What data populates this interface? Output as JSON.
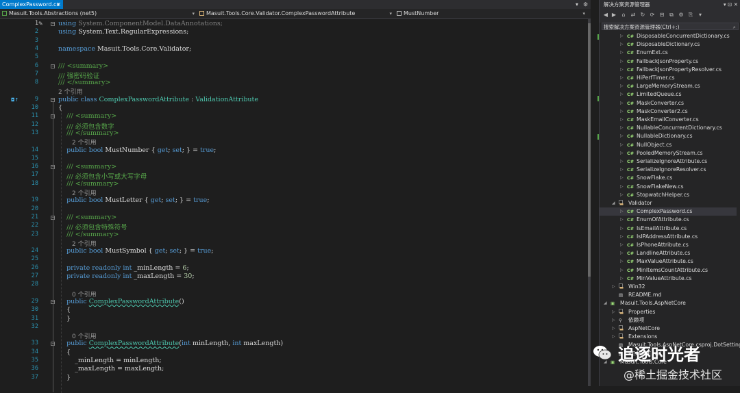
{
  "editor": {
    "tab_label": "ComplexPassword.cs",
    "nav": {
      "project": "Masuit.Tools.Abstractions (net5)",
      "type": "Masuit.Tools.Core.Validator.ComplexPasswordAttribute",
      "member": "MustNumber"
    },
    "lines": [
      {
        "n": "1",
        "parts": [
          {
            "t": "using ",
            "c": "kw"
          },
          {
            "t": "System.ComponentModel.DataAnnotations;",
            "c": "gr"
          }
        ]
      },
      {
        "n": "2",
        "parts": [
          {
            "t": "using ",
            "c": "kw"
          },
          {
            "t": "System.Text.RegularExpressions;",
            "c": ""
          }
        ]
      },
      {
        "n": "3",
        "parts": []
      },
      {
        "n": "4",
        "parts": [
          {
            "t": "namespace ",
            "c": "kw"
          },
          {
            "t": "Masuit.Tools.Core.Validator;",
            "c": ""
          }
        ]
      },
      {
        "n": "5",
        "parts": []
      },
      {
        "n": "6",
        "parts": [
          {
            "t": "/// <summary>",
            "c": "cm"
          }
        ]
      },
      {
        "n": "7",
        "parts": [
          {
            "t": "/// 强密码验证",
            "c": "cm"
          }
        ]
      },
      {
        "n": "8",
        "parts": [
          {
            "t": "/// </summary>",
            "c": "cm"
          }
        ]
      },
      {
        "n": "9",
        "parts": [
          {
            "t": "public ",
            "c": "kw"
          },
          {
            "t": "class ",
            "c": "kw"
          },
          {
            "t": "ComplexPasswordAttribute",
            "c": "ty"
          },
          {
            "t": " : ",
            "c": ""
          },
          {
            "t": "ValidationAttribute",
            "c": "ty"
          }
        ]
      },
      {
        "n": "10",
        "parts": [
          {
            "t": "{",
            "c": ""
          }
        ]
      },
      {
        "n": "11",
        "parts": [
          {
            "t": "    /// <summary>",
            "c": "cm"
          }
        ]
      },
      {
        "n": "12",
        "parts": [
          {
            "t": "    /// 必须包含数字",
            "c": "cm"
          }
        ]
      },
      {
        "n": "13",
        "parts": [
          {
            "t": "    /// </summary>",
            "c": "cm"
          }
        ]
      },
      {
        "n": "14",
        "parts": [
          {
            "t": "    public ",
            "c": "kw"
          },
          {
            "t": "bool ",
            "c": "kw"
          },
          {
            "t": "MustNumber { ",
            "c": ""
          },
          {
            "t": "get",
            "c": "kw"
          },
          {
            "t": "; ",
            "c": ""
          },
          {
            "t": "set",
            "c": "kw"
          },
          {
            "t": "; } = ",
            "c": ""
          },
          {
            "t": "true",
            "c": "kw"
          },
          {
            "t": ";",
            "c": ""
          }
        ]
      },
      {
        "n": "15",
        "parts": []
      },
      {
        "n": "16",
        "parts": [
          {
            "t": "    /// <summary>",
            "c": "cm"
          }
        ]
      },
      {
        "n": "17",
        "parts": [
          {
            "t": "    /// 必须包含小写或大写字母",
            "c": "cm"
          }
        ]
      },
      {
        "n": "18",
        "parts": [
          {
            "t": "    /// </summary>",
            "c": "cm"
          }
        ]
      },
      {
        "n": "19",
        "parts": [
          {
            "t": "    public ",
            "c": "kw"
          },
          {
            "t": "bool ",
            "c": "kw"
          },
          {
            "t": "MustLetter { ",
            "c": ""
          },
          {
            "t": "get",
            "c": "kw"
          },
          {
            "t": "; ",
            "c": ""
          },
          {
            "t": "set",
            "c": "kw"
          },
          {
            "t": "; } = ",
            "c": ""
          },
          {
            "t": "true",
            "c": "kw"
          },
          {
            "t": ";",
            "c": ""
          }
        ]
      },
      {
        "n": "20",
        "parts": []
      },
      {
        "n": "21",
        "parts": [
          {
            "t": "    /// <summary>",
            "c": "cm"
          }
        ]
      },
      {
        "n": "22",
        "parts": [
          {
            "t": "    /// 必须包含特殊符号",
            "c": "cm"
          }
        ]
      },
      {
        "n": "23",
        "parts": [
          {
            "t": "    /// </summary>",
            "c": "cm"
          }
        ]
      },
      {
        "n": "24",
        "parts": [
          {
            "t": "    public ",
            "c": "kw"
          },
          {
            "t": "bool ",
            "c": "kw"
          },
          {
            "t": "MustSymbol { ",
            "c": ""
          },
          {
            "t": "get",
            "c": "kw"
          },
          {
            "t": "; ",
            "c": ""
          },
          {
            "t": "set",
            "c": "kw"
          },
          {
            "t": "; } = ",
            "c": ""
          },
          {
            "t": "true",
            "c": "kw"
          },
          {
            "t": ";",
            "c": ""
          }
        ]
      },
      {
        "n": "25",
        "parts": []
      },
      {
        "n": "26",
        "parts": [
          {
            "t": "    private ",
            "c": "kw"
          },
          {
            "t": "readonly ",
            "c": "kw"
          },
          {
            "t": "int ",
            "c": "kw"
          },
          {
            "t": "_minLength = ",
            "c": ""
          },
          {
            "t": "6",
            "c": "nu"
          },
          {
            "t": ";",
            "c": ""
          }
        ]
      },
      {
        "n": "27",
        "parts": [
          {
            "t": "    private ",
            "c": "kw"
          },
          {
            "t": "readonly ",
            "c": "kw"
          },
          {
            "t": "int ",
            "c": "kw"
          },
          {
            "t": "_maxLength = ",
            "c": ""
          },
          {
            "t": "30",
            "c": "nu"
          },
          {
            "t": ";",
            "c": ""
          }
        ]
      },
      {
        "n": "28",
        "parts": []
      },
      {
        "n": "29",
        "parts": [
          {
            "t": "    public ",
            "c": "kw"
          },
          {
            "t": "ComplexPasswordAttribute",
            "c": "ty squig"
          },
          {
            "t": "()",
            "c": ""
          }
        ]
      },
      {
        "n": "30",
        "parts": [
          {
            "t": "    {",
            "c": ""
          }
        ]
      },
      {
        "n": "31",
        "parts": [
          {
            "t": "    }",
            "c": ""
          }
        ]
      },
      {
        "n": "32",
        "parts": []
      },
      {
        "n": "33",
        "parts": [
          {
            "t": "    public ",
            "c": "kw"
          },
          {
            "t": "ComplexPasswordAttribute",
            "c": "ty squig"
          },
          {
            "t": "(",
            "c": ""
          },
          {
            "t": "int ",
            "c": "kw"
          },
          {
            "t": "minLength, ",
            "c": ""
          },
          {
            "t": "int ",
            "c": "kw"
          },
          {
            "t": "maxLength)",
            "c": ""
          }
        ]
      },
      {
        "n": "34",
        "parts": [
          {
            "t": "    {",
            "c": ""
          }
        ]
      },
      {
        "n": "35",
        "parts": [
          {
            "t": "        _minLength = minLength;",
            "c": ""
          }
        ]
      },
      {
        "n": "36",
        "parts": [
          {
            "t": "        _maxLength = maxLength;",
            "c": ""
          }
        ]
      },
      {
        "n": "37",
        "parts": [
          {
            "t": "    }",
            "c": ""
          }
        ]
      }
    ],
    "refs": [
      {
        "after": "8",
        "text": "2 个引用"
      },
      {
        "after": "13",
        "text": "2 个引用"
      },
      {
        "after": "18",
        "text": "2 个引用"
      },
      {
        "after": "23",
        "text": "2 个引用"
      },
      {
        "after": "28",
        "text": "0 个引用"
      },
      {
        "after": "32",
        "text": "0 个引用"
      }
    ]
  },
  "solution_explorer": {
    "title": "解决方案资源管理器",
    "search_placeholder": "搜索解决方案资源管理器(Ctrl+;)",
    "items": [
      {
        "label": "DisposableConcurrentDictionary.cs",
        "kind": "cs",
        "depth": 3
      },
      {
        "label": "DisposableDictionary.cs",
        "kind": "cs",
        "depth": 3
      },
      {
        "label": "EnumExt.cs",
        "kind": "cs",
        "depth": 3
      },
      {
        "label": "FallbackJsonProperty.cs",
        "kind": "cs",
        "depth": 3
      },
      {
        "label": "FallbackJsonPropertyResolver.cs",
        "kind": "cs",
        "depth": 3
      },
      {
        "label": "HiPerfTimer.cs",
        "kind": "cs",
        "depth": 3
      },
      {
        "label": "LargeMemoryStream.cs",
        "kind": "cs",
        "depth": 3
      },
      {
        "label": "LimitedQueue.cs",
        "kind": "cs",
        "depth": 3
      },
      {
        "label": "MaskConverter.cs",
        "kind": "cs",
        "depth": 3
      },
      {
        "label": "MaskConverter2.cs",
        "kind": "cs",
        "depth": 3
      },
      {
        "label": "MaskEmailConverter.cs",
        "kind": "cs",
        "depth": 3
      },
      {
        "label": "NullableConcurrentDictionary.cs",
        "kind": "cs",
        "depth": 3
      },
      {
        "label": "NullableDictionary.cs",
        "kind": "cs",
        "depth": 3
      },
      {
        "label": "NullObject.cs",
        "kind": "cs",
        "depth": 3
      },
      {
        "label": "PooledMemoryStream.cs",
        "kind": "cs",
        "depth": 3
      },
      {
        "label": "SerializeIgnoreAttribute.cs",
        "kind": "cs",
        "depth": 3
      },
      {
        "label": "SerializeIgnoreResolver.cs",
        "kind": "cs",
        "depth": 3
      },
      {
        "label": "SnowFlake.cs",
        "kind": "cs",
        "depth": 3
      },
      {
        "label": "SnowFlakeNew.cs",
        "kind": "cs",
        "depth": 3
      },
      {
        "label": "StopwatchHelper.cs",
        "kind": "cs",
        "depth": 3
      },
      {
        "label": "Validator",
        "kind": "folder-open",
        "depth": 2
      },
      {
        "label": "ComplexPassword.cs",
        "kind": "cs",
        "depth": 3,
        "selected": true
      },
      {
        "label": "EnumOfAttribute.cs",
        "kind": "cs",
        "depth": 3
      },
      {
        "label": "IsEmailAttribute.cs",
        "kind": "cs",
        "depth": 3
      },
      {
        "label": "IsIPAddressAttribute.cs",
        "kind": "cs",
        "depth": 3
      },
      {
        "label": "IsPhoneAttribute.cs",
        "kind": "cs",
        "depth": 3
      },
      {
        "label": "LandlineAttribute.cs",
        "kind": "cs",
        "depth": 3
      },
      {
        "label": "MaxValueAttribute.cs",
        "kind": "cs",
        "depth": 3
      },
      {
        "label": "MinItemsCountAttribute.cs",
        "kind": "cs",
        "depth": 3
      },
      {
        "label": "MinValueAttribute.cs",
        "kind": "cs",
        "depth": 3
      },
      {
        "label": "Win32",
        "kind": "folder",
        "depth": 2
      },
      {
        "label": "README.md",
        "kind": "md",
        "depth": 2
      },
      {
        "label": "Masuit.Tools.AspNetCore",
        "kind": "project",
        "depth": 1
      },
      {
        "label": "Properties",
        "kind": "folder",
        "depth": 2
      },
      {
        "label": "依赖项",
        "kind": "deps",
        "depth": 2
      },
      {
        "label": "AspNetCore",
        "kind": "folder",
        "depth": 2
      },
      {
        "label": "Extensions",
        "kind": "folder",
        "depth": 2
      },
      {
        "label": "Masuit.Tools.AspNetCore.csproj.DotSettings",
        "kind": "md",
        "depth": 2
      },
      {
        "label": "README.md",
        "kind": "md",
        "depth": 2
      },
      {
        "label": "Masuit.Tools.Core",
        "kind": "project",
        "depth": 1
      }
    ]
  },
  "watermark": {
    "title": "追逐时光者",
    "subtitle": "@稀土掘金技术社区"
  }
}
